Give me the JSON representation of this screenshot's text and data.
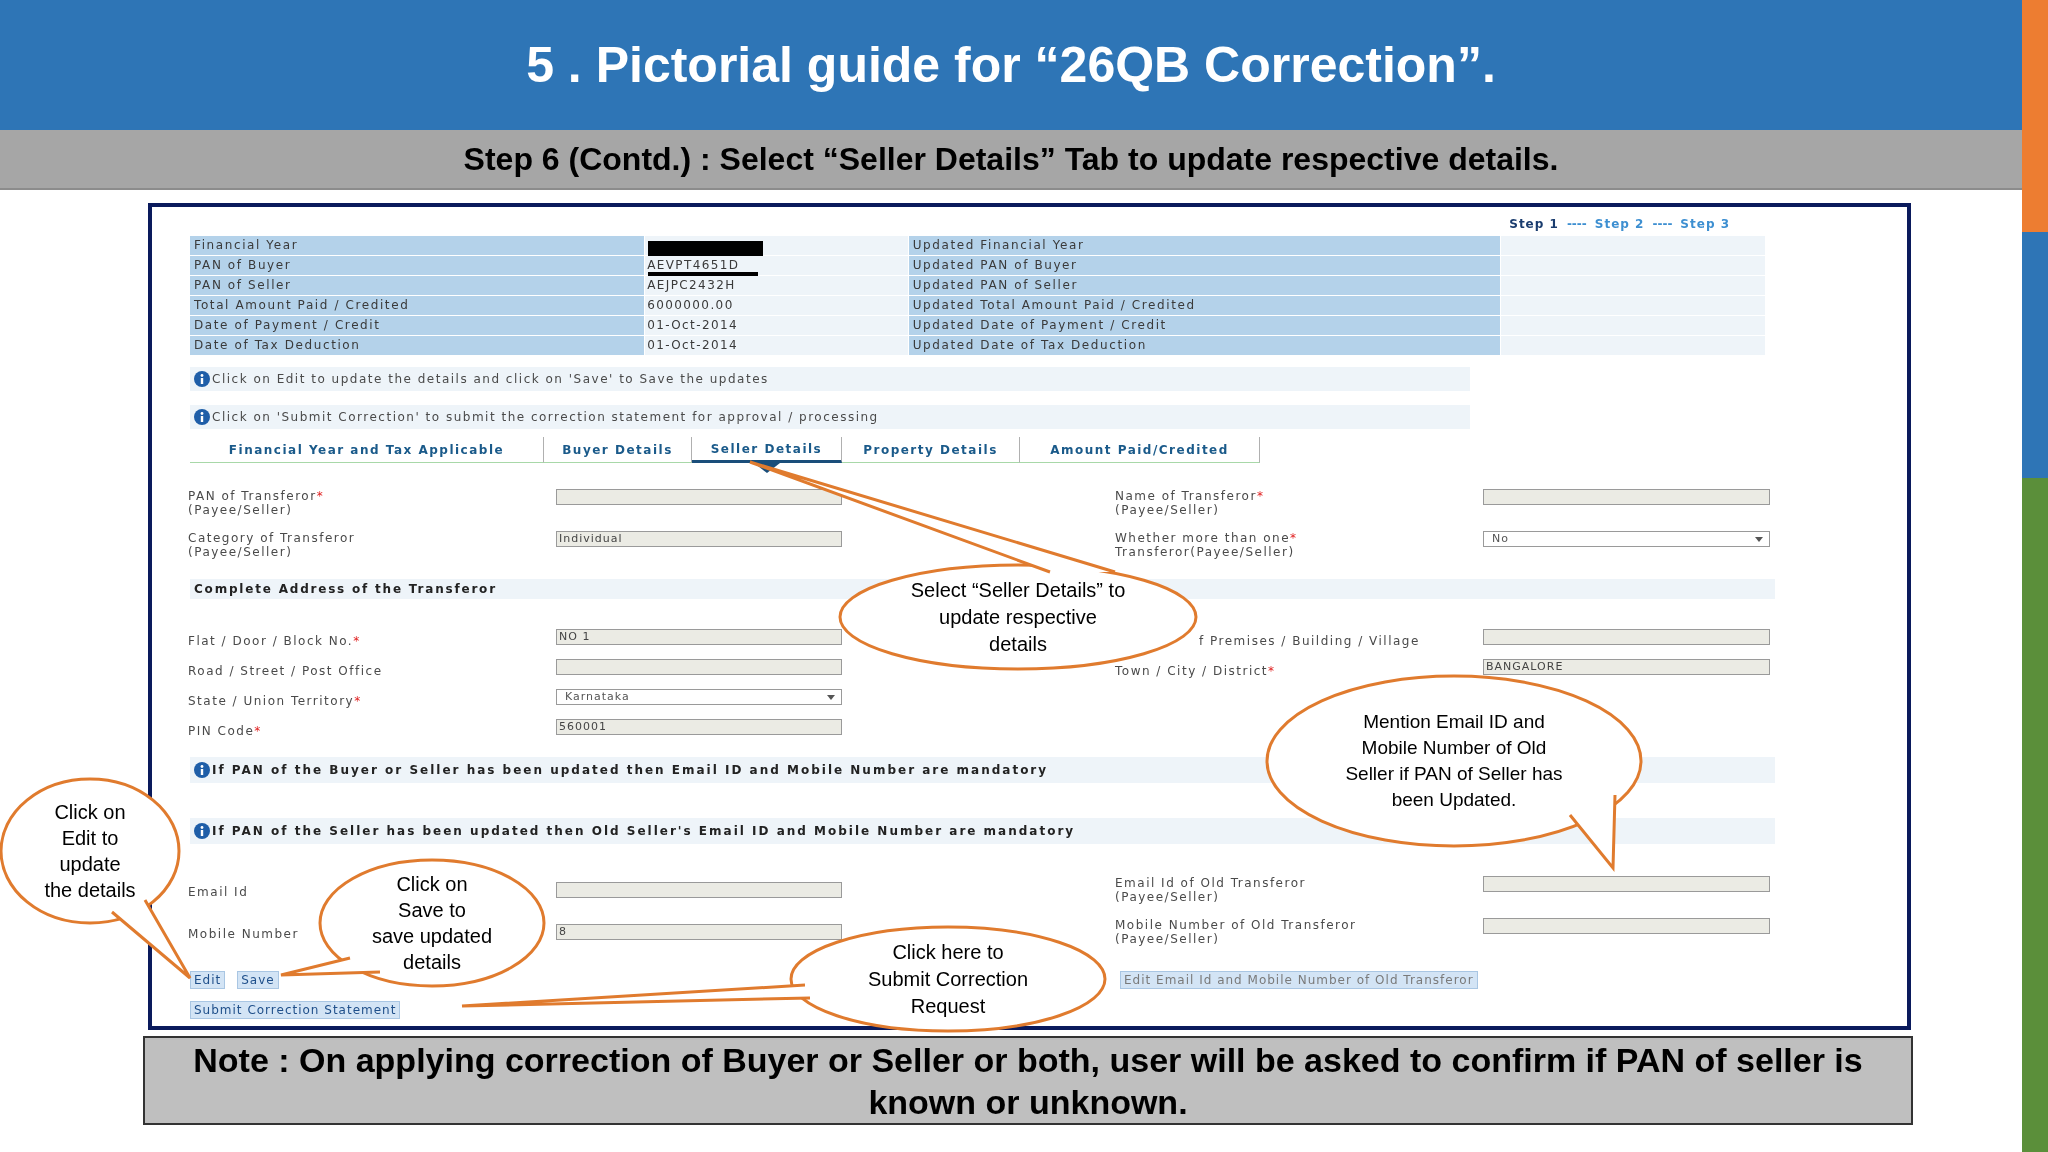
{
  "slide_title": "5 . Pictorial guide for “26QB Correction”.",
  "slide_subtitle": "Step 6 (Contd.) : Select “Seller Details” Tab to update respective details.",
  "steps": [
    {
      "kind": "step",
      "label": "Step 1",
      "selected": true
    },
    {
      "kind": "separator",
      "label": "----"
    },
    {
      "kind": "step",
      "label": "Step 2",
      "selected": false
    },
    {
      "kind": "separator",
      "label": "----"
    },
    {
      "kind": "step",
      "label": "Step 3",
      "selected": false
    }
  ],
  "summary_rows": [
    {
      "label": "Financial Year",
      "redacted": true,
      "updated_label": "Updated Financial Year"
    },
    {
      "label": "PAN of Buyer",
      "value": "AEVPT4651D",
      "redacted": true,
      "updated_label": "Updated PAN of Buyer"
    },
    {
      "label": "PAN of Seller",
      "value": "AEJPC2432H",
      "updated_label": "Updated PAN of Seller"
    },
    {
      "label": "Total Amount Paid / Credited",
      "value": "6000000.00",
      "updated_label": "Updated Total Amount Paid / Credited"
    },
    {
      "label": "Date of Payment / Credit",
      "value": "01-Oct-2014",
      "updated_label": "Updated Date of Payment / Credit"
    },
    {
      "label": "Date of Tax Deduction",
      "value": "01-Oct-2014",
      "updated_label": "Updated Date of Tax Deduction"
    }
  ],
  "notices": [
    "Click on Edit to update the details and click on 'Save' to Save the updates",
    "Click on 'Submit Correction' to submit the correction statement for approval / processing"
  ],
  "tabs": [
    {
      "label": "Financial Year and Tax Applicable",
      "selected": false
    },
    {
      "label": "Buyer Details",
      "selected": false
    },
    {
      "label": "Seller Details",
      "selected": true
    },
    {
      "label": "Property Details",
      "selected": false
    },
    {
      "label": "Amount Paid/Credited",
      "selected": false
    }
  ],
  "form_rows_1": [
    {
      "left": {
        "label": "PAN of Transferor",
        "required_mark": "*",
        "sublabel": "(Payee/Seller)",
        "kind": "text"
      },
      "right": {
        "label": "Name of Transferor",
        "required_mark": "*",
        "sublabel": "(Payee/Seller)",
        "kind": "text"
      }
    },
    {
      "left": {
        "label": "Category of Transferor",
        "sublabel": "(Payee/Seller)",
        "kind": "text",
        "value": "Individual"
      },
      "right": {
        "label": "Whether more than one",
        "required_mark": "*",
        "sublabel": "Transferor(Payee/Seller)",
        "kind": "select",
        "value": "No"
      }
    }
  ],
  "section_title": "Complete Address of the Transferor",
  "form_rows_2": [
    {
      "left": {
        "label": "Flat / Door / Block No.",
        "required_mark": "*",
        "kind": "text",
        "value": "NO 1"
      },
      "right": {
        "label": "f Premises / Building / Village",
        "kind": "text"
      }
    },
    {
      "left": {
        "label": "Road / Street / Post Office",
        "kind": "text"
      },
      "right": {
        "label": "Town / City / District",
        "required_mark": "*",
        "kind": "text",
        "value": "BANGALORE"
      }
    },
    {
      "left": {
        "label": "State / Union Territory",
        "required_mark": "*",
        "kind": "select",
        "value": "Karnataka"
      }
    },
    {
      "left": {
        "label": "PIN Code",
        "required_mark": "*",
        "kind": "text",
        "value": "560001"
      }
    }
  ],
  "mandatory_notices": [
    "If PAN of the Buyer or Seller has been updated then Email ID and Mobile Number are mandatory",
    "If PAN of the Seller has been updated then Old Seller's Email ID and Mobile Number are mandatory"
  ],
  "form_rows_3": [
    {
      "left": {
        "label": "Email Id",
        "kind": "text"
      },
      "right": {
        "label": "Email Id of Old Transferor",
        "sublabel": "(Payee/Seller)",
        "kind": "text"
      }
    },
    {
      "left": {
        "label": "Mobile Number",
        "kind": "text",
        "value": "8"
      },
      "right": {
        "label": "Mobile Number of Old Transferor",
        "sublabel": "(Payee/Seller)",
        "kind": "text"
      }
    }
  ],
  "action_buttons": [
    {
      "label": "Edit",
      "disabled": false
    },
    {
      "label": "Save",
      "disabled": false
    }
  ],
  "old_transferor_button": {
    "label": "Edit Email Id and Mobile Number of Old Transferor",
    "disabled": true
  },
  "submit_button": {
    "label": "Submit Correction Statement",
    "disabled": false
  },
  "note": "Note : On applying correction of Buyer or Seller or both, user will be asked to confirm if PAN of seller is known or unknown.",
  "callouts": [
    {
      "lines": [
        "Select “Seller Details” to",
        "update respective",
        "details"
      ]
    },
    {
      "lines": [
        "Mention Email ID and",
        "Mobile Number of  Old",
        "Seller if PAN of Seller has",
        "been Updated."
      ]
    },
    {
      "lines": [
        "Click on",
        "Edit to",
        "update",
        "the details"
      ]
    },
    {
      "lines": [
        "Click on",
        "Save to",
        "save updated",
        "details"
      ]
    },
    {
      "lines": [
        "Click here to",
        "Submit Correction",
        "Request"
      ]
    }
  ]
}
